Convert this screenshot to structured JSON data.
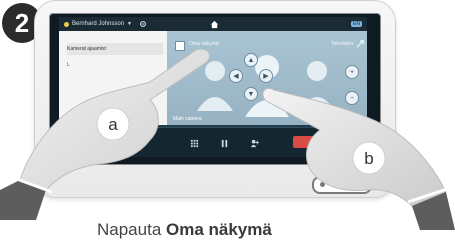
{
  "step": {
    "number": "2"
  },
  "tablet": {
    "status_bar": {
      "user_name": "Bernhard Johnsson",
      "language": "EN"
    },
    "side_panel": {
      "title": "Kamerat ajaamist",
      "row_label": "L"
    },
    "self_view": {
      "label": "Oma näkymä",
      "tv_label": "Television"
    },
    "main_camera_label": "Main camera"
  },
  "callouts": [
    {
      "letter": "a"
    },
    {
      "letter": "b"
    }
  ],
  "caption": {
    "prefix": "Napauta ",
    "bold": "Oma näkymä"
  }
}
